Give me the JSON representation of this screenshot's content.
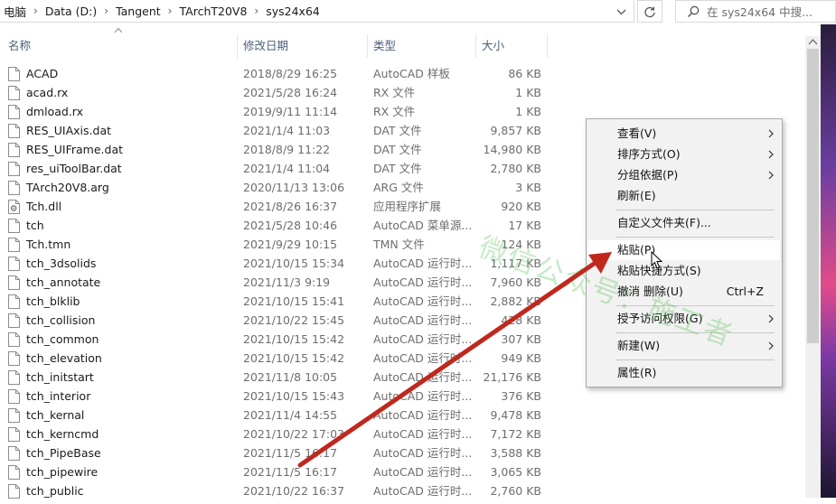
{
  "address": {
    "crumbs": [
      "电脑",
      "Data (D:)",
      "Tangent",
      "TArchT20V8",
      "sys24x64"
    ],
    "search_placeholder": "在 sys24x64 中搜..."
  },
  "columns": {
    "name": "名称",
    "date": "修改日期",
    "type": "类型",
    "size": "大小"
  },
  "files": [
    {
      "name": "ACAD",
      "date": "2018/8/29 16:25",
      "type": "AutoCAD 样板",
      "size": "86 KB"
    },
    {
      "name": "acad.rx",
      "date": "2021/5/28 16:24",
      "type": "RX 文件",
      "size": "1 KB"
    },
    {
      "name": "dmload.rx",
      "date": "2019/9/11 11:14",
      "type": "RX 文件",
      "size": "1 KB"
    },
    {
      "name": "RES_UIAxis.dat",
      "date": "2021/1/4 11:03",
      "type": "DAT 文件",
      "size": "9,857 KB"
    },
    {
      "name": "RES_UIFrame.dat",
      "date": "2018/8/9 11:22",
      "type": "DAT 文件",
      "size": "14,980 KB"
    },
    {
      "name": "res_uiToolBar.dat",
      "date": "2021/1/4 11:04",
      "type": "DAT 文件",
      "size": "2,780 KB"
    },
    {
      "name": "TArch20V8.arg",
      "date": "2020/11/13 13:06",
      "type": "ARG 文件",
      "size": "3 KB"
    },
    {
      "name": "Tch.dll",
      "date": "2021/8/26 16:37",
      "type": "应用程序扩展",
      "size": "920 KB",
      "icon": "dll"
    },
    {
      "name": "tch",
      "date": "2021/5/28 10:46",
      "type": "AutoCAD 菜单源...",
      "size": "17 KB"
    },
    {
      "name": "Tch.tmn",
      "date": "2021/9/29 10:15",
      "type": "TMN 文件",
      "size": "124 KB"
    },
    {
      "name": "tch_3dsolids",
      "date": "2021/10/15 15:34",
      "type": "AutoCAD 运行时...",
      "size": "1,117 KB"
    },
    {
      "name": "tch_annotate",
      "date": "2021/11/3 9:19",
      "type": "AutoCAD 运行时...",
      "size": "7,960 KB"
    },
    {
      "name": "tch_blklib",
      "date": "2021/10/15 15:41",
      "type": "AutoCAD 运行时...",
      "size": "2,882 KB"
    },
    {
      "name": "tch_collision",
      "date": "2021/10/22 15:45",
      "type": "AutoCAD 运行时...",
      "size": "428 KB"
    },
    {
      "name": "tch_common",
      "date": "2021/10/15 15:42",
      "type": "AutoCAD 运行时...",
      "size": "307 KB"
    },
    {
      "name": "tch_elevation",
      "date": "2021/10/15 15:42",
      "type": "AutoCAD 运行时...",
      "size": "949 KB"
    },
    {
      "name": "tch_initstart",
      "date": "2021/11/8 10:05",
      "type": "AutoCAD 运行时...",
      "size": "21,176 KB"
    },
    {
      "name": "tch_interior",
      "date": "2021/10/15 15:43",
      "type": "AutoCAD 运行时...",
      "size": "376 KB"
    },
    {
      "name": "tch_kernal",
      "date": "2021/11/4 14:55",
      "type": "AutoCAD 运行时...",
      "size": "9,478 KB"
    },
    {
      "name": "tch_kerncmd",
      "date": "2021/10/22 17:03",
      "type": "AutoCAD 运行时...",
      "size": "7,172 KB"
    },
    {
      "name": "tch_PipeBase",
      "date": "2021/11/5 16:17",
      "type": "AutoCAD 运行时...",
      "size": "3,588 KB"
    },
    {
      "name": "tch_pipewire",
      "date": "2021/11/5 16:17",
      "type": "AutoCAD 运行时...",
      "size": "3,065 KB"
    },
    {
      "name": "tch_public",
      "date": "2021/10/22 16:37",
      "type": "AutoCAD 运行时...",
      "size": "2,760 KB"
    }
  ],
  "context_menu": {
    "view": "查看(V)",
    "sort": "排序方式(O)",
    "group": "分组依据(P)",
    "refresh": "刷新(E)",
    "customize": "自定义文件夹(F)...",
    "paste": "粘贴(P)",
    "paste_shortcut": "粘贴快捷方式(S)",
    "undo": "撤消 删除(U)",
    "undo_shortcut": "Ctrl+Z",
    "access": "授予访问权限(G)",
    "new": "新建(W)",
    "properties": "属性(R)"
  },
  "watermark": "微信公众号：施工者",
  "colors": {
    "arrow": "#c0281e",
    "header_text": "#4c607a",
    "menu_bg": "#f2f2f2"
  }
}
